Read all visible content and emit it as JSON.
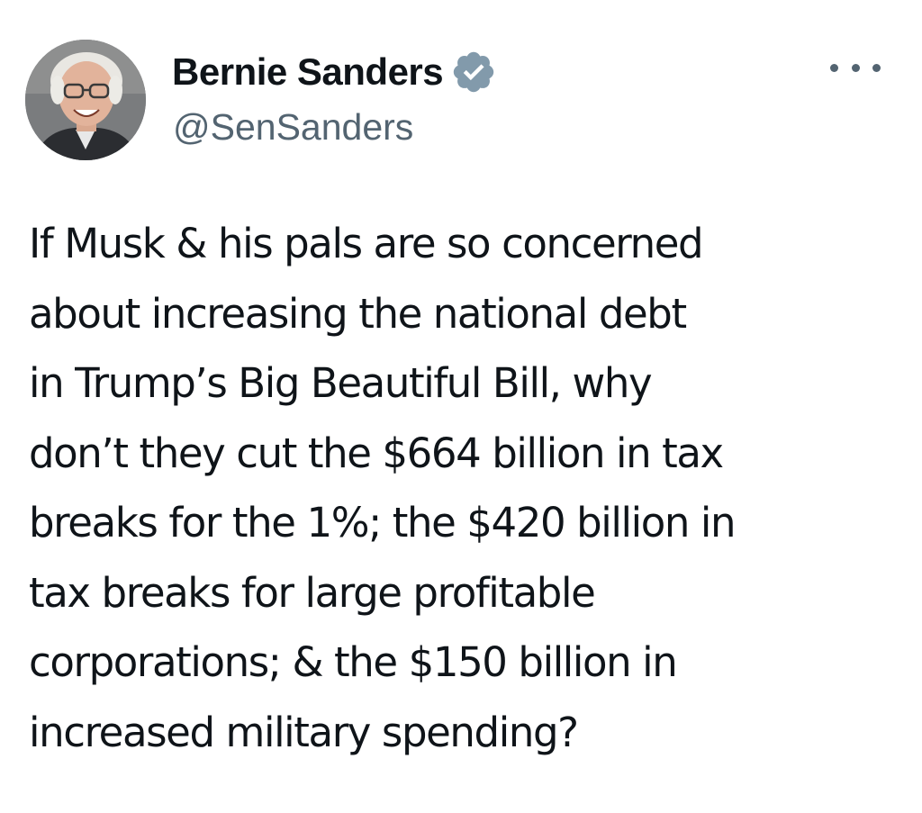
{
  "author": {
    "display_name": "Bernie Sanders",
    "handle": "@SenSanders",
    "verified": true,
    "avatar": "profile-photo"
  },
  "menu": {
    "icon": "more-options-icon"
  },
  "tweet": {
    "text": "If Musk & his pals are so concerned\nabout increasing the national debt\nin Trump’s Big Beautiful Bill, why\ndon’t they cut the $664 billion in tax\nbreaks for the 1%; the $420 billion in\ntax breaks for large profitable\ncorporations; & the $150 billion in\nincreased military spending?"
  },
  "colors": {
    "verified_badge": "#829aab",
    "secondary_text": "#536471",
    "primary_text": "#0f1419"
  }
}
